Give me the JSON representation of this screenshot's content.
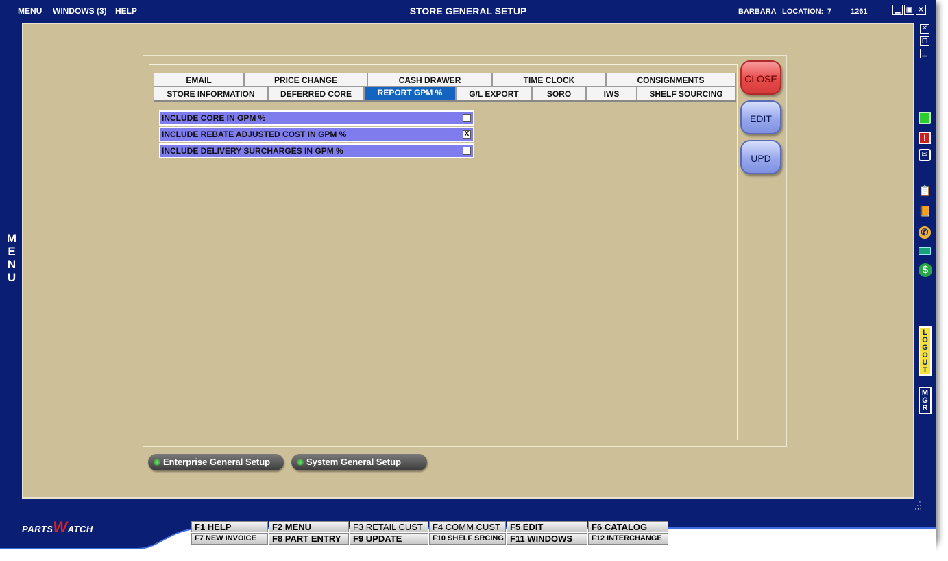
{
  "menubar": {
    "menu": "MENU",
    "windows": "WINDOWS (3)",
    "help": "HELP"
  },
  "window": {
    "title": "STORE GENERAL SETUP",
    "user": "BARBARA",
    "location_label": "LOCATION:",
    "location_value": "7",
    "terminal": "1261"
  },
  "side_menu": {
    "letters": [
      "M",
      "E",
      "N",
      "U"
    ]
  },
  "tabs": {
    "row1": [
      "EMAIL",
      "PRICE CHANGE",
      "CASH DRAWER",
      "TIME CLOCK",
      "CONSIGNMENTS"
    ],
    "row2": [
      "STORE INFORMATION",
      "DEFERRED CORE",
      "REPORT GPM %",
      "G/L EXPORT",
      "SORO",
      "IWS",
      "SHELF SOURCING"
    ],
    "active": "REPORT GPM %"
  },
  "options": [
    {
      "label": "INCLUDE CORE IN GPM %",
      "mark": ""
    },
    {
      "label": "INCLUDE REBATE ADJUSTED COST IN GPM %",
      "mark": "X"
    },
    {
      "label": "INCLUDE DELIVERY SURCHARGES IN GPM %",
      "mark": ""
    }
  ],
  "actions": {
    "close": "CLOSE",
    "edit": "EDIT",
    "update": "UPD"
  },
  "links": {
    "enterprise_pre": "Enterprise ",
    "enterprise_u": "G",
    "enterprise_post": "eneral Setup",
    "system_pre": "System General Se",
    "system_u": "t",
    "system_post": "up"
  },
  "right_sidebar": {
    "logout": [
      "L",
      "O",
      "G",
      "O",
      "U",
      "T"
    ],
    "mgr": [
      "M",
      "G",
      "R"
    ]
  },
  "brand": {
    "pre": "PARTS",
    "w": "W",
    "post": "ATCH"
  },
  "fkeys": {
    "f1": "F1 HELP",
    "f2": "F2 MENU",
    "f3": "F3 RETAIL CUST",
    "f4": "F4 COMM CUST",
    "f5": "F5 EDIT",
    "f6": "F6 CATALOG",
    "f7": "F7 NEW INVOICE",
    "f8": "F8 PART ENTRY",
    "f9": "F9 UPDATE",
    "f10": "F10 SHELF SRCING",
    "f11": "F11 WINDOWS",
    "f12": "F12 INTERCHANGE"
  },
  "colors": {
    "frame": "#0a1e73",
    "panel": "#cdbf98",
    "option_row": "#7f7dee",
    "active_tab": "#1565c0",
    "close": "#e84a4a",
    "blue_btn": "#98a8ec"
  }
}
